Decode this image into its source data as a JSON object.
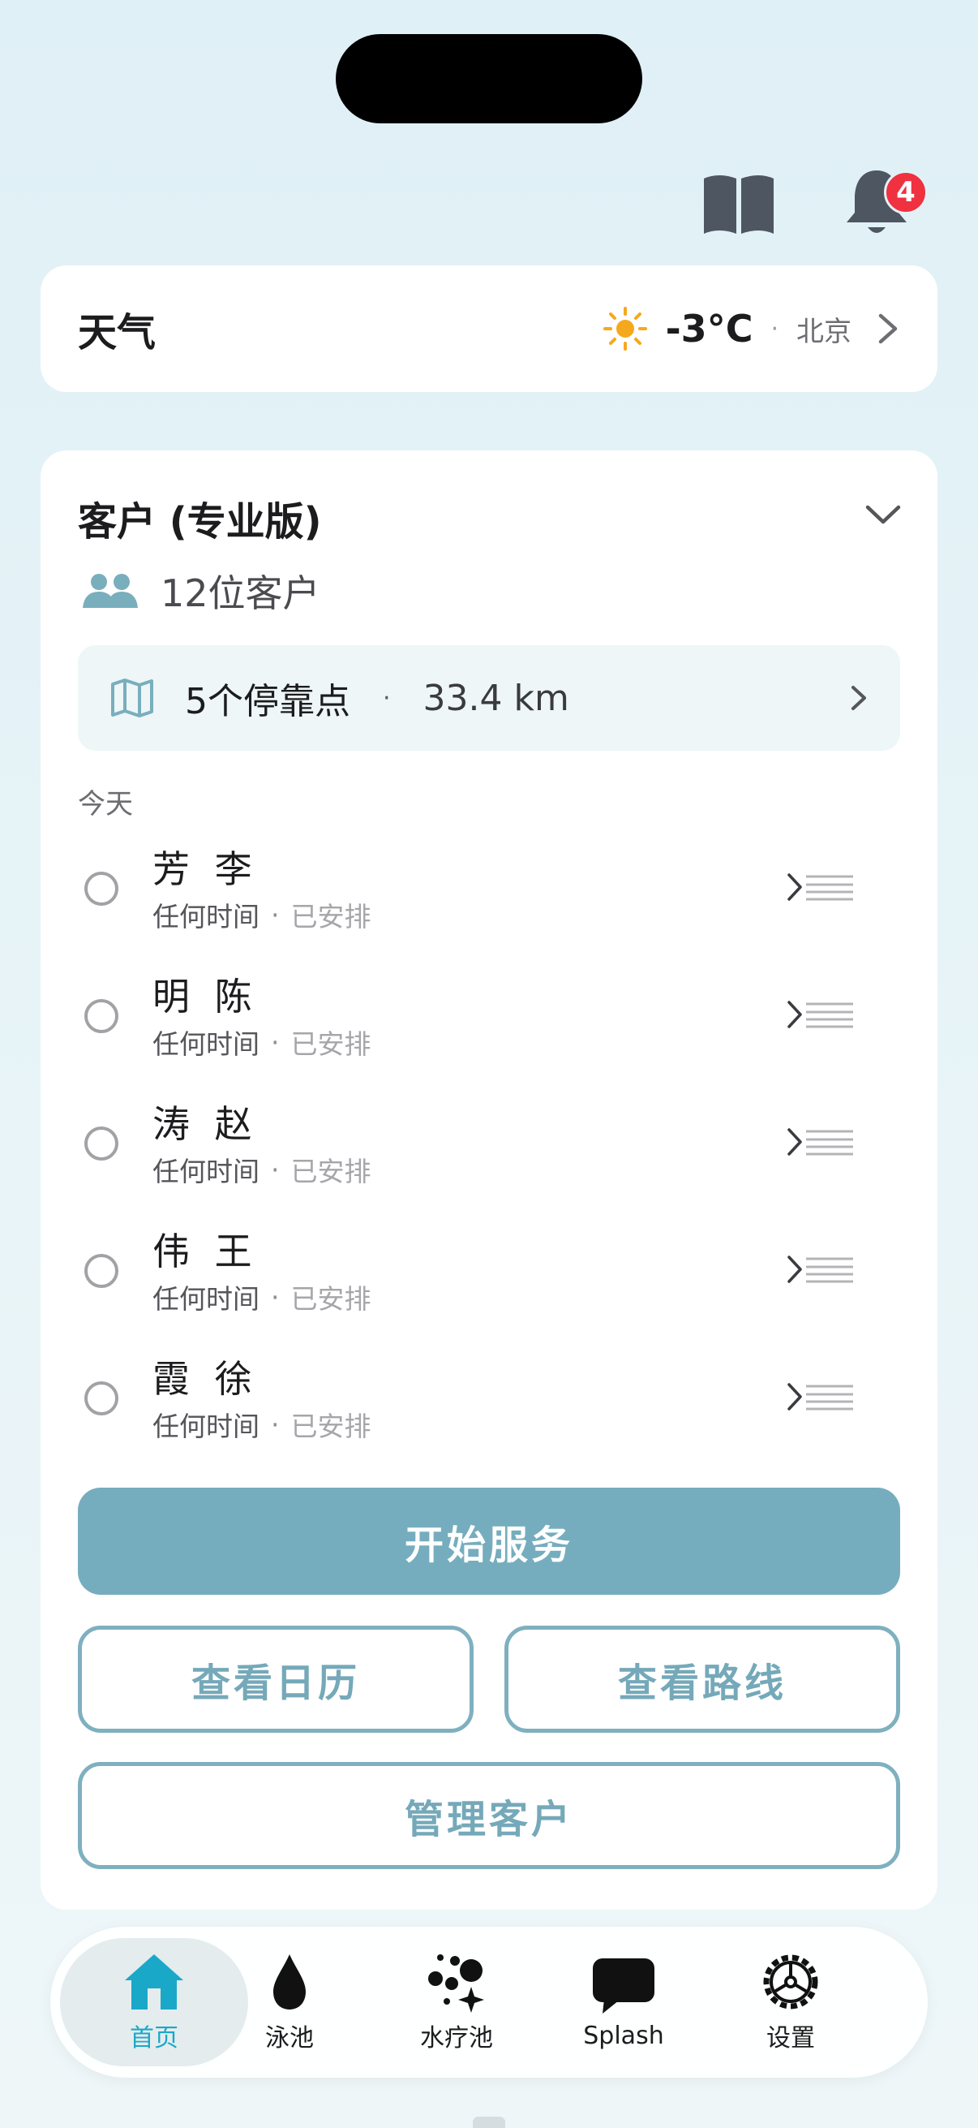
{
  "header": {
    "notification_count": "4"
  },
  "weather": {
    "title": "天气",
    "temperature": "-3°C",
    "separator": "·",
    "city": "北京"
  },
  "clients": {
    "title": "客户 (专业版)",
    "count_text": "12位客户",
    "route": {
      "stops": "5个停靠点",
      "separator": "·",
      "distance": "33.4 km"
    },
    "today_label": "今天",
    "items": [
      {
        "name": "芳 李",
        "time": "任何时间",
        "separator": "·",
        "status": "已安排"
      },
      {
        "name": "明 陈",
        "time": "任何时间",
        "separator": "·",
        "status": "已安排"
      },
      {
        "name": "涛 赵",
        "time": "任何时间",
        "separator": "·",
        "status": "已安排"
      },
      {
        "name": "伟 王",
        "time": "任何时间",
        "separator": "·",
        "status": "已安排"
      },
      {
        "name": "霞 徐",
        "time": "任何时间",
        "separator": "·",
        "status": "已安排"
      }
    ],
    "buttons": {
      "start_service": "开始服务",
      "view_calendar": "查看日历",
      "view_route": "查看路线",
      "manage_clients": "管理客户"
    }
  },
  "tabs": [
    {
      "label": "首页",
      "icon": "home-icon",
      "active": true
    },
    {
      "label": "泳池",
      "icon": "water-drop-icon",
      "active": false
    },
    {
      "label": "水疗池",
      "icon": "bubbles-sparkle-icon",
      "active": false
    },
    {
      "label": "Splash",
      "icon": "chat-bubble-icon",
      "active": false
    },
    {
      "label": "设置",
      "icon": "gear-icon",
      "active": false
    }
  ],
  "colors": {
    "accent": "#75adbe",
    "active_tab": "#1aa8c9",
    "badge": "#f0313f",
    "sun": "#f6a81c"
  }
}
